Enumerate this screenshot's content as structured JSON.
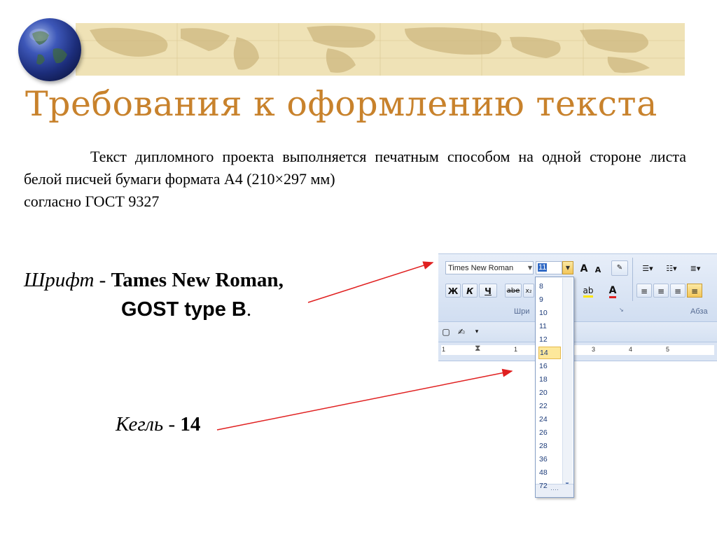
{
  "header": {
    "title": "Требования к оформлению текста"
  },
  "body": {
    "paragraph_line1": "Текст дипломного проекта выполняется печатным способом на",
    "paragraph_line2": "одной стороне листа белой писчей бумаги формата А4 (210×297 мм)",
    "paragraph_line3": "согласно ГОСТ 9327",
    "font_label": "Шрифт",
    "font_sep": " - ",
    "font_value": "Tames New Roman",
    "font_comma": ",",
    "font_value2": "GOST type B",
    "font_value2_dot": ".",
    "size_label": "Кегль",
    "size_sep": " - ",
    "size_value": "14"
  },
  "ribbon": {
    "font_name": "Times New Roman",
    "font_size": "11",
    "grow_font": "A",
    "shrink_font": "A",
    "bold": "Ж",
    "italic": "К",
    "underline": "Ч",
    "strikethrough": "abe",
    "subscript": "x₂",
    "font_color": "A",
    "group_font_label": "Шри",
    "group_paragraph_label": "Абза",
    "ruler_marks": [
      "1",
      "1",
      "3",
      "4",
      "5"
    ]
  },
  "dropdown": {
    "options": [
      "8",
      "9",
      "10",
      "11",
      "12",
      "14",
      "16",
      "18",
      "20",
      "22",
      "24",
      "26",
      "28",
      "36",
      "48",
      "72"
    ],
    "selected": "14"
  },
  "colors": {
    "title": "#c8822c",
    "arrow": "#e02020",
    "ribbon": "#d6e2f3",
    "highlight": "#fde89b"
  }
}
